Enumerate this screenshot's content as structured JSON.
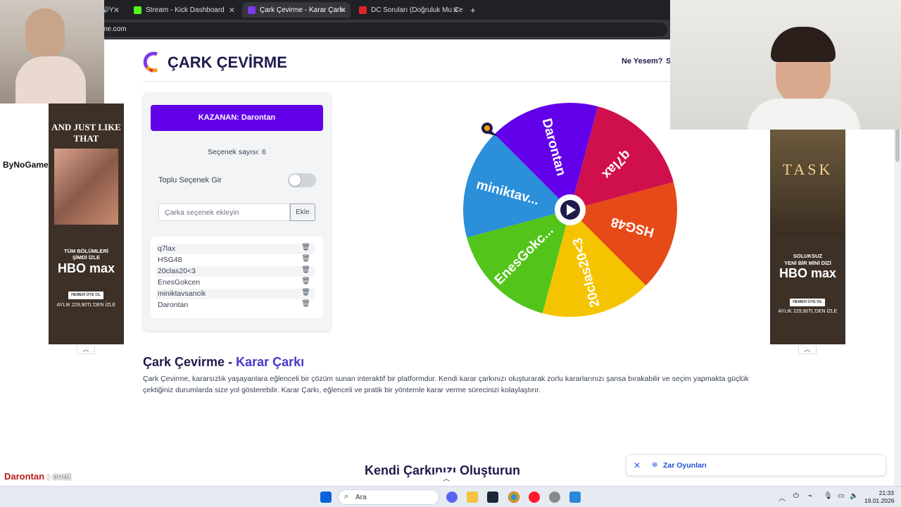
{
  "browser": {
    "tabs": [
      {
        "label": "AVHAVHAV - Y",
        "fav_color": "#ff0000",
        "active": false
      },
      {
        "label": "Stream - Kick Dashboard",
        "fav_color": "#53fc18",
        "active": false
      },
      {
        "label": "Çark Çevirme - Karar Çarkı",
        "fav_color": "#7c3aed",
        "active": true
      },
      {
        "label": "DC Soruları (Doğruluk Mu Cesa",
        "fav_color": "#dc2626",
        "active": false
      }
    ],
    "url": "carkcevirme.com"
  },
  "site": {
    "title": "ÇARK ÇEVİRME",
    "nav": [
      "Ne Yesem?",
      "S"
    ]
  },
  "panel": {
    "winner_label": "KAZANAN: Darontan",
    "option_count": "Seçenek sayısı: 6",
    "bulk_label": "Toplu Seçenek Gir",
    "bulk_enabled": false,
    "input_placeholder": "Çarka seçenek ekleyin",
    "add_label": "Ekle",
    "options": [
      "q7lax",
      "HSG48",
      "20clas20<3",
      "EnesGokcen",
      "miniktavsancik",
      "Darontan"
    ]
  },
  "wheel": {
    "segments": [
      {
        "label": "q7lax",
        "color": "#d0104c"
      },
      {
        "label": "HSG48",
        "color": "#e64a19"
      },
      {
        "label": "20clas20<3",
        "color": "#f5c400"
      },
      {
        "label": "EnesGokc...",
        "color": "#52c41a"
      },
      {
        "label": "miniktav...",
        "color": "#2b8fd9"
      },
      {
        "label": "Darontan",
        "color": "#6200ea"
      }
    ]
  },
  "about": {
    "title_main": "Çark Çevirme - ",
    "title_accent": "Karar Çarkı",
    "text": "Çark Çevirme, kararsızlık yaşayanlara eğlenceli bir çözüm sunan interaktif bir platformdur. Kendi karar çarkınızı oluşturarak zorlu kararlarınızı şansa bırakabilir ve seçim yapmakta güçlük çektiğiniz durumlarda size yol gösterebilir. Karar Çarkı, eğlenceli ve pratik bir yöntemle karar verme sürecinizi kolaylaştırır."
  },
  "create_title": "Kendi Çarkınızı Oluşturun",
  "ads": {
    "left": {
      "top": "AND JUST LIKE THAT",
      "line1": "TÜM BÖLÜMLERİ",
      "line2": "ŞİMDİ İZLE",
      "brand": "HBO max",
      "cta": "HEMEN ÜYE OL",
      "price": "AYLIK 229,90TL'DEN İZLE"
    },
    "right": {
      "top": "TASK",
      "line1": "SOLUKSUZ",
      "line2": "YENİ BİR MİNİ DİZİ",
      "brand": "HBO max",
      "cta": "HEMEN ÜYE OL",
      "price": "AYLIK 229,90TL'DEN İZLE"
    }
  },
  "zar_bar": {
    "label": "Zar Oyunları"
  },
  "overlay": {
    "sponsor": "ByNoGame",
    "chat_user": "Darontan",
    "chat_sep": " : ",
    "chat_msg": "evet"
  },
  "taskbar": {
    "search_label": "Ara",
    "time": "21:33",
    "date": "19.01.2026"
  }
}
